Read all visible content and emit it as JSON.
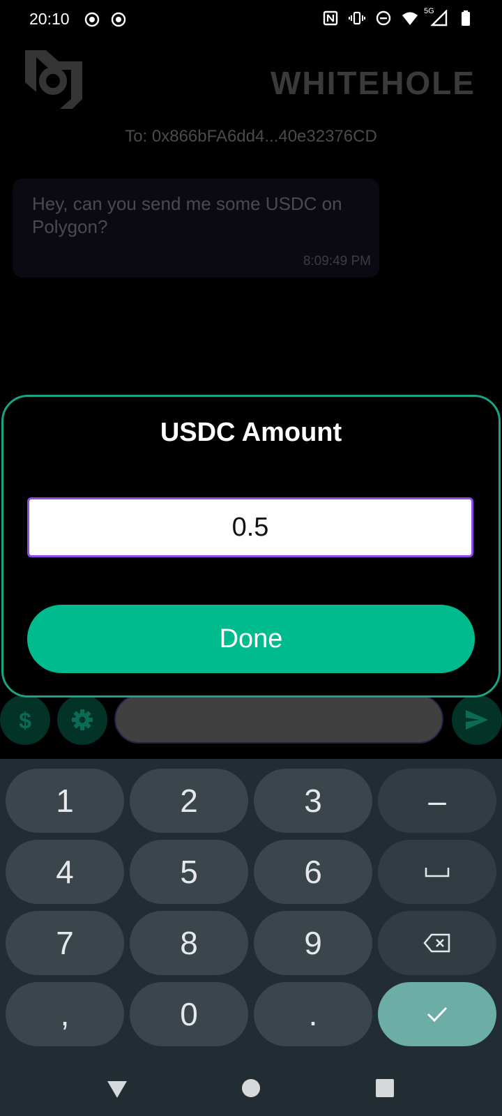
{
  "status_bar": {
    "time": "20:10",
    "left_icons": [
      "broadcast-icon",
      "broadcast-icon"
    ],
    "network": "5G",
    "right_icons": [
      "nfc-icon",
      "vibrate-icon",
      "dnd-icon",
      "wifi-icon",
      "signal-icon",
      "battery-icon"
    ]
  },
  "header": {
    "brand": "WHITEHOLE",
    "recipient": "To: 0x866bFA6dd4...40e32376CD"
  },
  "messages": [
    {
      "text": "Hey, can you send me some USDC on Polygon?",
      "time": "8:09:49 PM"
    }
  ],
  "composer": {
    "icons": [
      "dollar-icon",
      "gear-icon",
      "send-icon"
    ]
  },
  "modal": {
    "title": "USDC Amount",
    "amount_value": "0.5",
    "done_label": "Done"
  },
  "keyboard": {
    "keys": [
      [
        "1",
        "2",
        "3",
        "–"
      ],
      [
        "4",
        "5",
        "6",
        "␣"
      ],
      [
        "7",
        "8",
        "9",
        "⌫"
      ],
      [
        ",",
        "0",
        ".",
        "✓"
      ]
    ]
  },
  "nav_bar": {
    "icons": [
      "back-icon",
      "home-icon",
      "recents-icon"
    ]
  },
  "colors": {
    "accent": "#00bb8e",
    "modal_border": "#1aa486",
    "input_border": "#8c4be6",
    "keyboard_bg": "#222c33",
    "enter_key": "#6cada5"
  }
}
